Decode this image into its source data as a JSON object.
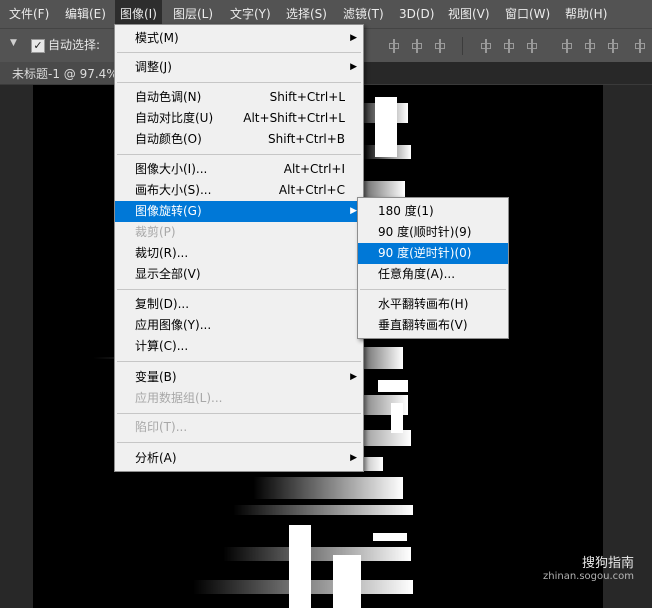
{
  "menubar": {
    "items": [
      "文件(F)",
      "编辑(E)",
      "图像(I)",
      "图层(L)",
      "文字(Y)",
      "选择(S)",
      "滤镜(T)",
      "3D(D)",
      "视图(V)",
      "窗口(W)",
      "帮助(H)"
    ],
    "active_index": 2
  },
  "options": {
    "auto_select_label": "自动选择:",
    "auto_select_checked": true
  },
  "doc_tab": {
    "title": "未标题-1 @ 97.4%"
  },
  "image_menu": {
    "items": {
      "mode": {
        "label": "模式(M)"
      },
      "adjust": {
        "label": "调整(J)"
      },
      "auto_tone": {
        "label": "自动色调(N)",
        "shortcut": "Shift+Ctrl+L"
      },
      "auto_contrast": {
        "label": "自动对比度(U)",
        "shortcut": "Alt+Shift+Ctrl+L"
      },
      "auto_color": {
        "label": "自动颜色(O)",
        "shortcut": "Shift+Ctrl+B"
      },
      "image_size": {
        "label": "图像大小(I)...",
        "shortcut": "Alt+Ctrl+I"
      },
      "canvas_size": {
        "label": "画布大小(S)...",
        "shortcut": "Alt+Ctrl+C"
      },
      "rotation": {
        "label": "图像旋转(G)"
      },
      "crop": {
        "label": "裁剪(P)"
      },
      "trim": {
        "label": "裁切(R)..."
      },
      "reveal_all": {
        "label": "显示全部(V)"
      },
      "duplicate": {
        "label": "复制(D)..."
      },
      "apply_image": {
        "label": "应用图像(Y)..."
      },
      "calculations": {
        "label": "计算(C)..."
      },
      "variables": {
        "label": "变量(B)"
      },
      "apply_dataset": {
        "label": "应用数据组(L)..."
      },
      "trap": {
        "label": "陷印(T)..."
      },
      "analysis": {
        "label": "分析(A)"
      }
    }
  },
  "rotation_submenu": {
    "items": {
      "r180": {
        "label": "180 度(1)"
      },
      "r90cw": {
        "label": "90 度(顺时针)(9)"
      },
      "r90ccw": {
        "label": "90 度(逆时针)(0)"
      },
      "arbitrary": {
        "label": "任意角度(A)..."
      },
      "flip_h": {
        "label": "水平翻转画布(H)"
      },
      "flip_v": {
        "label": "垂直翻转画布(V)"
      }
    }
  },
  "watermark": {
    "logo": "搜狗指南",
    "url": "zhinan.sogou.com"
  },
  "colors": {
    "menu_highlight": "#0078d7",
    "menubar_bg": "#535353",
    "canvas_bg": "#000000"
  }
}
